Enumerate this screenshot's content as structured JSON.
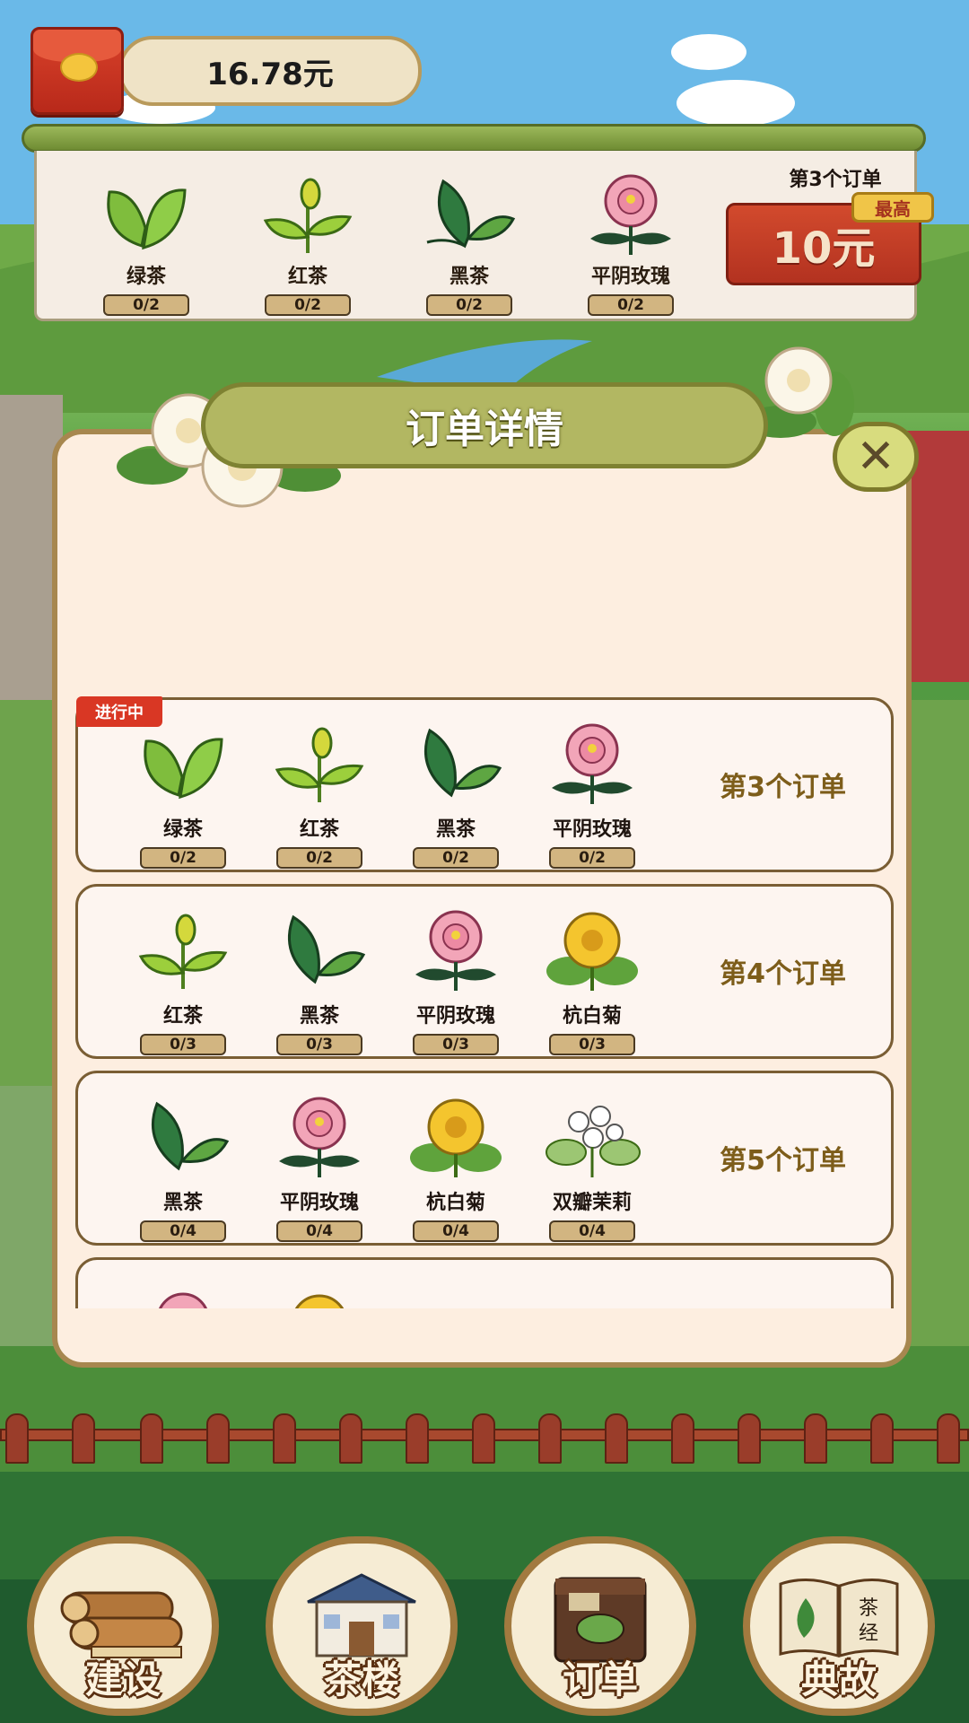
{
  "balance": "16.78元",
  "top_panel": {
    "items": [
      {
        "name": "绿茶",
        "progress": "0/2",
        "icon": "green-tea-leaf-icon"
      },
      {
        "name": "红茶",
        "progress": "0/2",
        "icon": "red-tea-sprout-icon"
      },
      {
        "name": "黑茶",
        "progress": "0/2",
        "icon": "black-tea-leaf-icon"
      },
      {
        "name": "平阴玫瑰",
        "progress": "0/2",
        "icon": "rose-icon"
      }
    ],
    "order_label": "第3个订单",
    "reward": "10元",
    "badge": "最高"
  },
  "modal": {
    "title": "订单详情",
    "status_tag": "进行中",
    "orders": [
      {
        "title": "第3个订单",
        "items": [
          {
            "name": "绿茶",
            "progress": "0/2",
            "icon": "green-tea-leaf-icon"
          },
          {
            "name": "红茶",
            "progress": "0/2",
            "icon": "red-tea-sprout-icon"
          },
          {
            "name": "黑茶",
            "progress": "0/2",
            "icon": "black-tea-leaf-icon"
          },
          {
            "name": "平阴玫瑰",
            "progress": "0/2",
            "icon": "rose-icon"
          }
        ]
      },
      {
        "title": "第4个订单",
        "items": [
          {
            "name": "红茶",
            "progress": "0/3",
            "icon": "red-tea-sprout-icon"
          },
          {
            "name": "黑茶",
            "progress": "0/3",
            "icon": "black-tea-leaf-icon"
          },
          {
            "name": "平阴玫瑰",
            "progress": "0/3",
            "icon": "rose-icon"
          },
          {
            "name": "杭白菊",
            "progress": "0/3",
            "icon": "chrysanthemum-icon"
          }
        ]
      },
      {
        "title": "第5个订单",
        "items": [
          {
            "name": "黑茶",
            "progress": "0/4",
            "icon": "black-tea-leaf-icon"
          },
          {
            "name": "平阴玫瑰",
            "progress": "0/4",
            "icon": "rose-icon"
          },
          {
            "name": "杭白菊",
            "progress": "0/4",
            "icon": "chrysanthemum-icon"
          },
          {
            "name": "双瓣茉莉",
            "progress": "0/4",
            "icon": "jasmine-icon"
          }
        ]
      }
    ]
  },
  "nav": [
    {
      "label": "建设",
      "icon": "logs-icon"
    },
    {
      "label": "茶楼",
      "icon": "teahouse-icon"
    },
    {
      "label": "订单",
      "icon": "tea-box-icon"
    },
    {
      "label": "典故",
      "icon": "book-icon"
    }
  ],
  "book_text": "茶经"
}
